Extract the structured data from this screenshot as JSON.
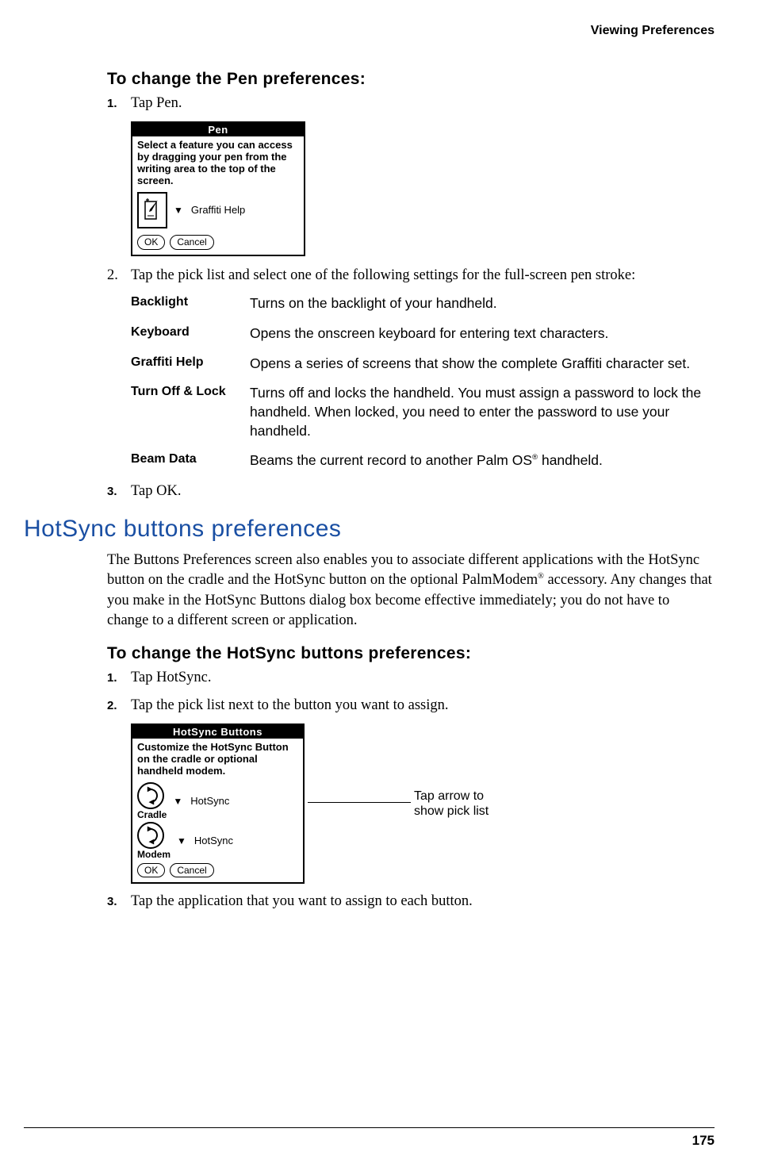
{
  "running_head": "Viewing Preferences",
  "section1": {
    "title": "To change the Pen preferences:",
    "steps": [
      {
        "num": "1.",
        "text": "Tap Pen.",
        "bold_num": true
      },
      {
        "num": "2.",
        "text": "Tap the pick list and select one of the following settings for the full-screen pen stroke:",
        "bold_num": false
      },
      {
        "num": "3.",
        "text": "Tap OK.",
        "bold_num": true
      }
    ]
  },
  "pen_dialog": {
    "title": "Pen",
    "instr": "Select a feature you can access by dragging your pen from the writing area to the top of the screen.",
    "selected": "Graffiti Help",
    "ok": "OK",
    "cancel": "Cancel"
  },
  "settings": [
    {
      "term": "Backlight",
      "desc": "Turns on the backlight of your handheld."
    },
    {
      "term": "Keyboard",
      "desc": "Opens the onscreen keyboard for entering text characters."
    },
    {
      "term": "Graffiti Help",
      "desc": "Opens a series of screens that show the complete Graffiti character set."
    },
    {
      "term": "Turn Off & Lock",
      "desc": "Turns off and locks the handheld. You must assign a password to lock the handheld. When locked, you need to enter the password to use your handheld."
    },
    {
      "term": "Beam Data",
      "desc_pre": "Beams the current record to another Palm OS",
      "desc_post": " handheld."
    }
  ],
  "h2": "HotSync buttons preferences",
  "para_pre": "The Buttons Preferences screen also enables you to associate different applications with the HotSync button on the cradle and the HotSync button on the optional PalmModem",
  "para_post": " accessory. Any changes that you make in the HotSync Buttons dialog box become effective immediately; you do not have to change to a different screen or application.",
  "section2": {
    "title": "To change the HotSync buttons preferences:",
    "steps": [
      {
        "num": "1.",
        "text": "Tap HotSync.",
        "bold_num": true
      },
      {
        "num": "2.",
        "text": "Tap the pick list next to the button you want to assign.",
        "bold_num": true
      },
      {
        "num": "3.",
        "text": "Tap the application that you want to assign to each button.",
        "bold_num": true
      }
    ]
  },
  "hs_dialog": {
    "title": "HotSync Buttons",
    "instr": "Customize the HotSync Button on the cradle or optional handheld modem.",
    "row1_label": "Cradle",
    "row1_value": "HotSync",
    "row2_label": "Modem",
    "row2_value": "HotSync",
    "ok": "OK",
    "cancel": "Cancel"
  },
  "callout": "Tap arrow to show pick list",
  "page_number": "175",
  "reg_mark": "®"
}
